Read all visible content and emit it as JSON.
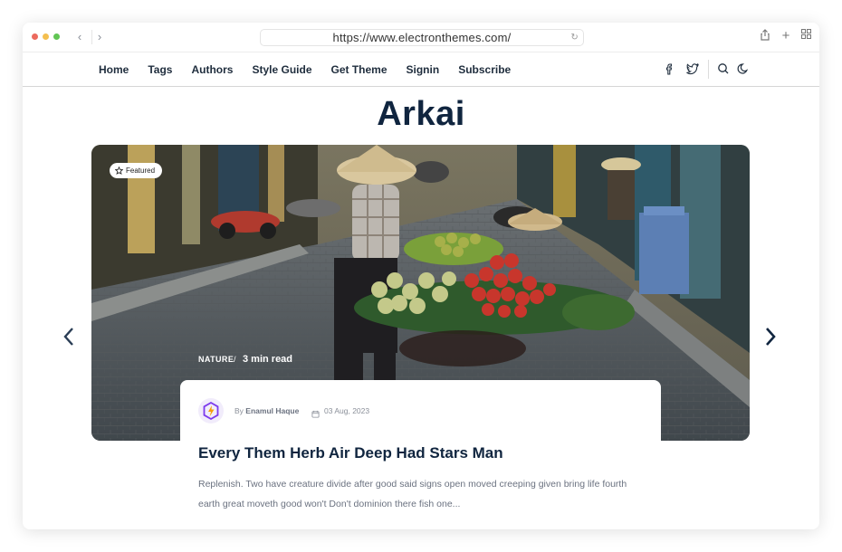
{
  "browser": {
    "url": "https://www.electronthemes.com/"
  },
  "nav": {
    "items": [
      "Home",
      "Tags",
      "Authors",
      "Style Guide",
      "Get Theme",
      "Signin",
      "Subscribe"
    ]
  },
  "site": {
    "title": "Arkai"
  },
  "featured": {
    "badge": "Featured",
    "category": "NATURE",
    "separator": "/",
    "read_time": "3 min read",
    "byline_prefix": "By",
    "author": "Enamul Haque",
    "date": "03 Aug, 2023",
    "title": "Every Them Herb Air Deep Had Stars Man",
    "excerpt": "Replenish. Two have creature divide after good said signs open moved creeping given bring life fourth earth great moveth good won't Don't dominion there fish one..."
  },
  "colors": {
    "accent": "#10253f",
    "avatar_purple": "#7c3aed",
    "avatar_orange": "#f59e0b"
  }
}
